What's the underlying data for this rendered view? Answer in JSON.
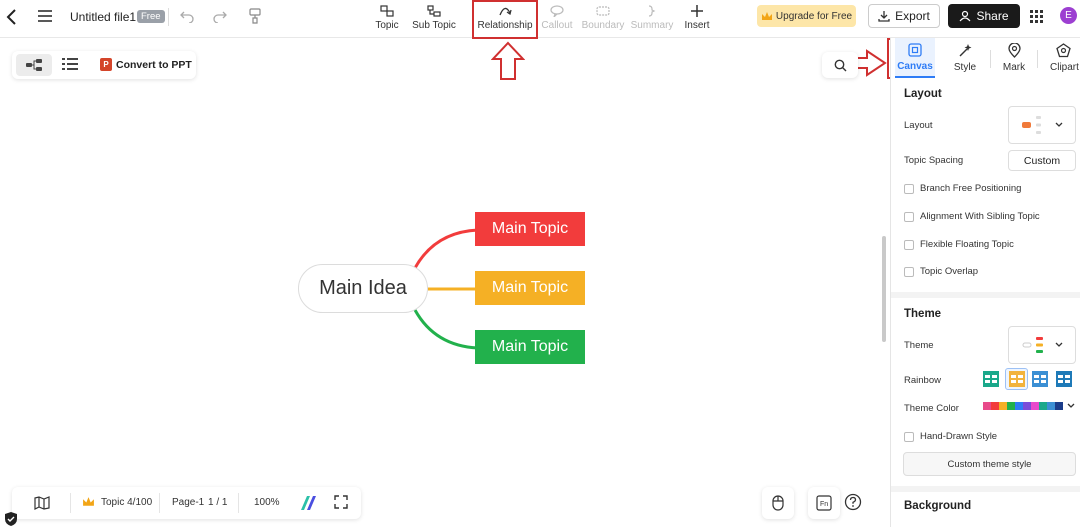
{
  "header": {
    "file_name": "Untitled file1",
    "plan_badge": "Free",
    "tools": [
      {
        "label": "Topic"
      },
      {
        "label": "Sub Topic"
      },
      {
        "label": "Relationship"
      },
      {
        "label": "Callout"
      },
      {
        "label": "Boundary"
      },
      {
        "label": "Summary"
      },
      {
        "label": "Insert"
      }
    ],
    "upgrade_label": "Upgrade for Free",
    "export_label": "Export",
    "share_label": "Share",
    "avatar_initial": "E"
  },
  "toolbar": {
    "convert_label": "Convert to PPT"
  },
  "mindmap": {
    "central": "Main Idea",
    "topics": [
      {
        "label": "Main Topic",
        "color": "#f23c3c"
      },
      {
        "label": "Main Topic",
        "color": "#f5b025"
      },
      {
        "label": "Main Topic",
        "color": "#22b14c"
      }
    ]
  },
  "statusbar": {
    "topic_count": "Topic 4/100",
    "page_name": "Page-1",
    "page_index": "1 / 1",
    "zoom": "100%"
  },
  "panel": {
    "tabs": [
      {
        "label": "Canvas"
      },
      {
        "label": "Style"
      },
      {
        "label": "Mark"
      },
      {
        "label": "Clipart"
      }
    ],
    "layout_section": "Layout",
    "layout_label": "Layout",
    "topic_spacing_label": "Topic Spacing",
    "custom_label": "Custom",
    "options": [
      {
        "label": "Branch Free Positioning"
      },
      {
        "label": "Alignment With Sibling Topic"
      },
      {
        "label": "Flexible Floating Topic"
      },
      {
        "label": "Topic Overlap"
      }
    ],
    "theme_section": "Theme",
    "theme_label": "Theme",
    "rainbow_label": "Rainbow",
    "theme_color_label": "Theme Color",
    "hand_drawn_label": "Hand-Drawn Style",
    "custom_theme_label": "Custom theme style",
    "background_section": "Background"
  },
  "colors": {
    "accent": "#2e7cf6",
    "annotation": "#d03030"
  }
}
